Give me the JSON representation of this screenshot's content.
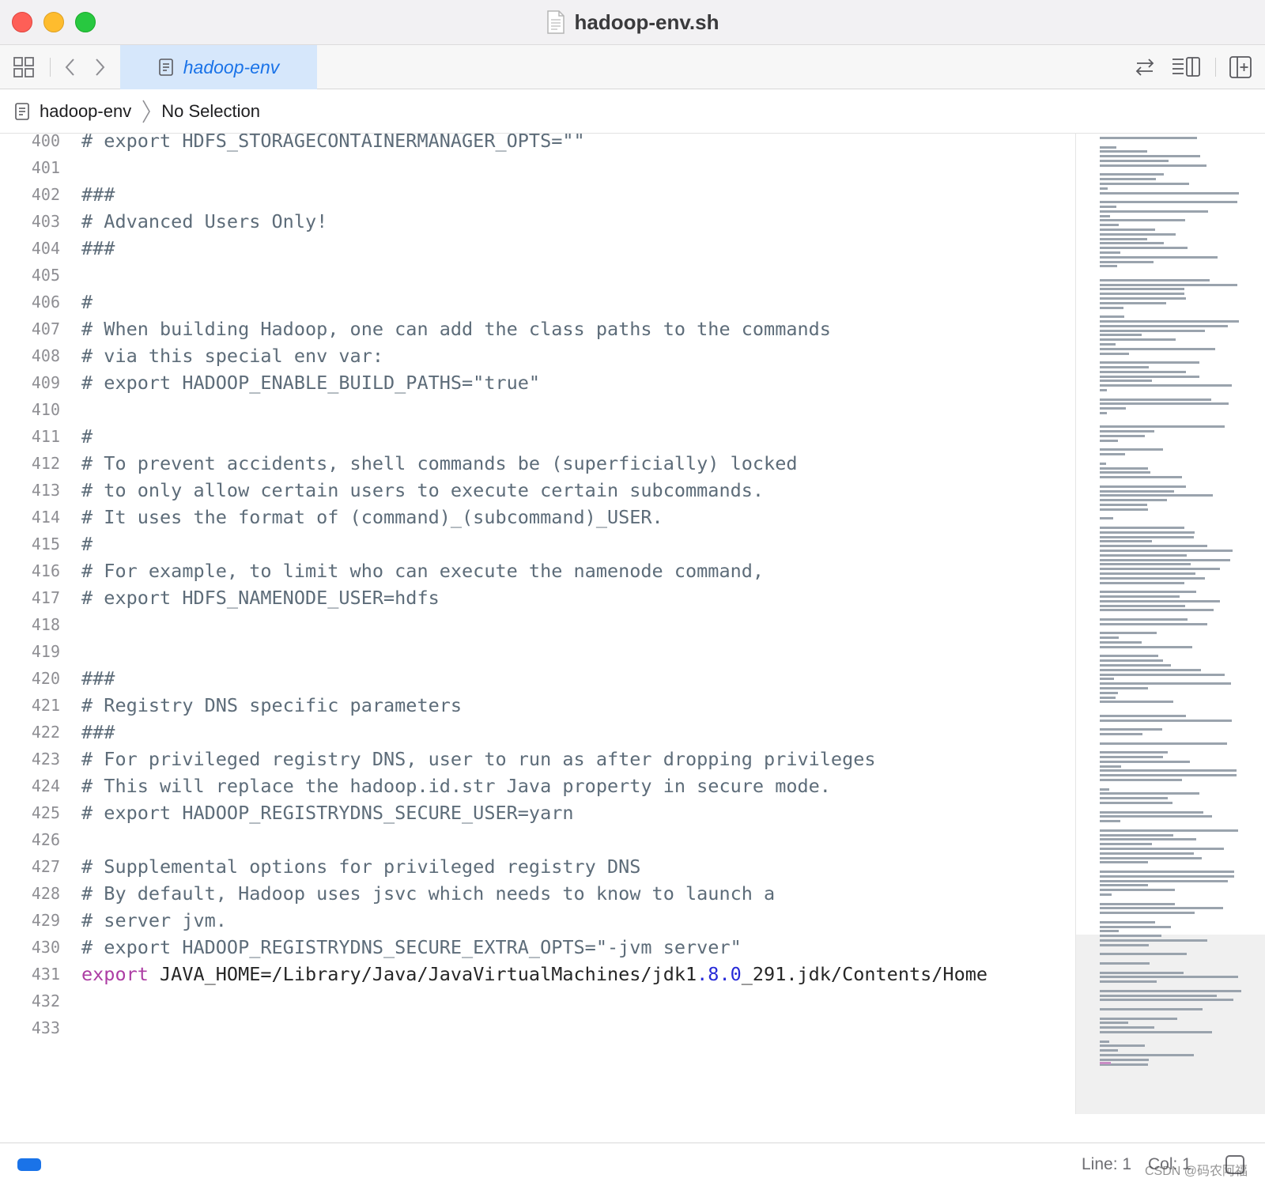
{
  "window": {
    "title": "hadoop-env.sh",
    "doc_icon": "document-icon"
  },
  "toolbar": {
    "tab_label": "hadoop-env",
    "icons": [
      "grid-view-icon",
      "back-chevron-icon",
      "forward-chevron-icon",
      "document-icon",
      "swap-arrows-icon",
      "inspector-toggle-icon",
      "add-editor-icon"
    ]
  },
  "jumpbar": {
    "file": "hadoop-env",
    "selection": "No Selection"
  },
  "code_lines": [
    {
      "n": "400",
      "text": "# export HDFS_STORAGECONTAINERMANAGER_OPTS=\"\""
    },
    {
      "n": "401",
      "text": ""
    },
    {
      "n": "402",
      "text": "###"
    },
    {
      "n": "403",
      "text": "# Advanced Users Only!"
    },
    {
      "n": "404",
      "text": "###"
    },
    {
      "n": "405",
      "text": ""
    },
    {
      "n": "406",
      "text": "#"
    },
    {
      "n": "407",
      "text": "# When building Hadoop, one can add the class paths to the commands"
    },
    {
      "n": "408",
      "text": "# via this special env var:"
    },
    {
      "n": "409",
      "text": "# export HADOOP_ENABLE_BUILD_PATHS=\"true\""
    },
    {
      "n": "410",
      "text": ""
    },
    {
      "n": "411",
      "text": "#"
    },
    {
      "n": "412",
      "text": "# To prevent accidents, shell commands be (superficially) locked"
    },
    {
      "n": "413",
      "text": "# to only allow certain users to execute certain subcommands."
    },
    {
      "n": "414",
      "text": "# It uses the format of (command)_(subcommand)_USER."
    },
    {
      "n": "415",
      "text": "#"
    },
    {
      "n": "416",
      "text": "# For example, to limit who can execute the namenode command,"
    },
    {
      "n": "417",
      "text": "# export HDFS_NAMENODE_USER=hdfs"
    },
    {
      "n": "418",
      "text": ""
    },
    {
      "n": "419",
      "text": ""
    },
    {
      "n": "420",
      "text": "###"
    },
    {
      "n": "421",
      "text": "# Registry DNS specific parameters"
    },
    {
      "n": "422",
      "text": "###"
    },
    {
      "n": "423",
      "text": "# For privileged registry DNS, user to run as after dropping privileges"
    },
    {
      "n": "424",
      "text": "# This will replace the hadoop.id.str Java property in secure mode."
    },
    {
      "n": "425",
      "text": "# export HADOOP_REGISTRYDNS_SECURE_USER=yarn"
    },
    {
      "n": "426",
      "text": ""
    },
    {
      "n": "427",
      "text": "# Supplemental options for privileged registry DNS"
    },
    {
      "n": "428",
      "text": "# By default, Hadoop uses jsvc which needs to know to launch a"
    },
    {
      "n": "429",
      "text": "# server jvm."
    },
    {
      "n": "430",
      "text": "# export HADOOP_REGISTRYDNS_SECURE_EXTRA_OPTS=\"-jvm server\""
    },
    {
      "n": "431",
      "text": "",
      "tokens": [
        {
          "t": "export",
          "c": "kw"
        },
        {
          "t": " JAVA_HOME=/Library/Java/JavaVirtualMachines/jdk1",
          "c": "plain"
        },
        {
          "t": ".8.0",
          "c": "num"
        },
        {
          "t": "_291.jdk/Contents/Home",
          "c": "plain"
        }
      ]
    },
    {
      "n": "432",
      "text": ""
    },
    {
      "n": "433",
      "text": ""
    }
  ],
  "colors": {
    "comment": "#5d6c79",
    "keyword": "#ad3da4",
    "number": "#272ad8",
    "plain": "#262626",
    "tab_bg": "#d6e7fb",
    "accent": "#1a73e8"
  },
  "status": {
    "line": "Line: 1",
    "col": "Col: 1",
    "watermark": "CSDN @码农阿福"
  }
}
